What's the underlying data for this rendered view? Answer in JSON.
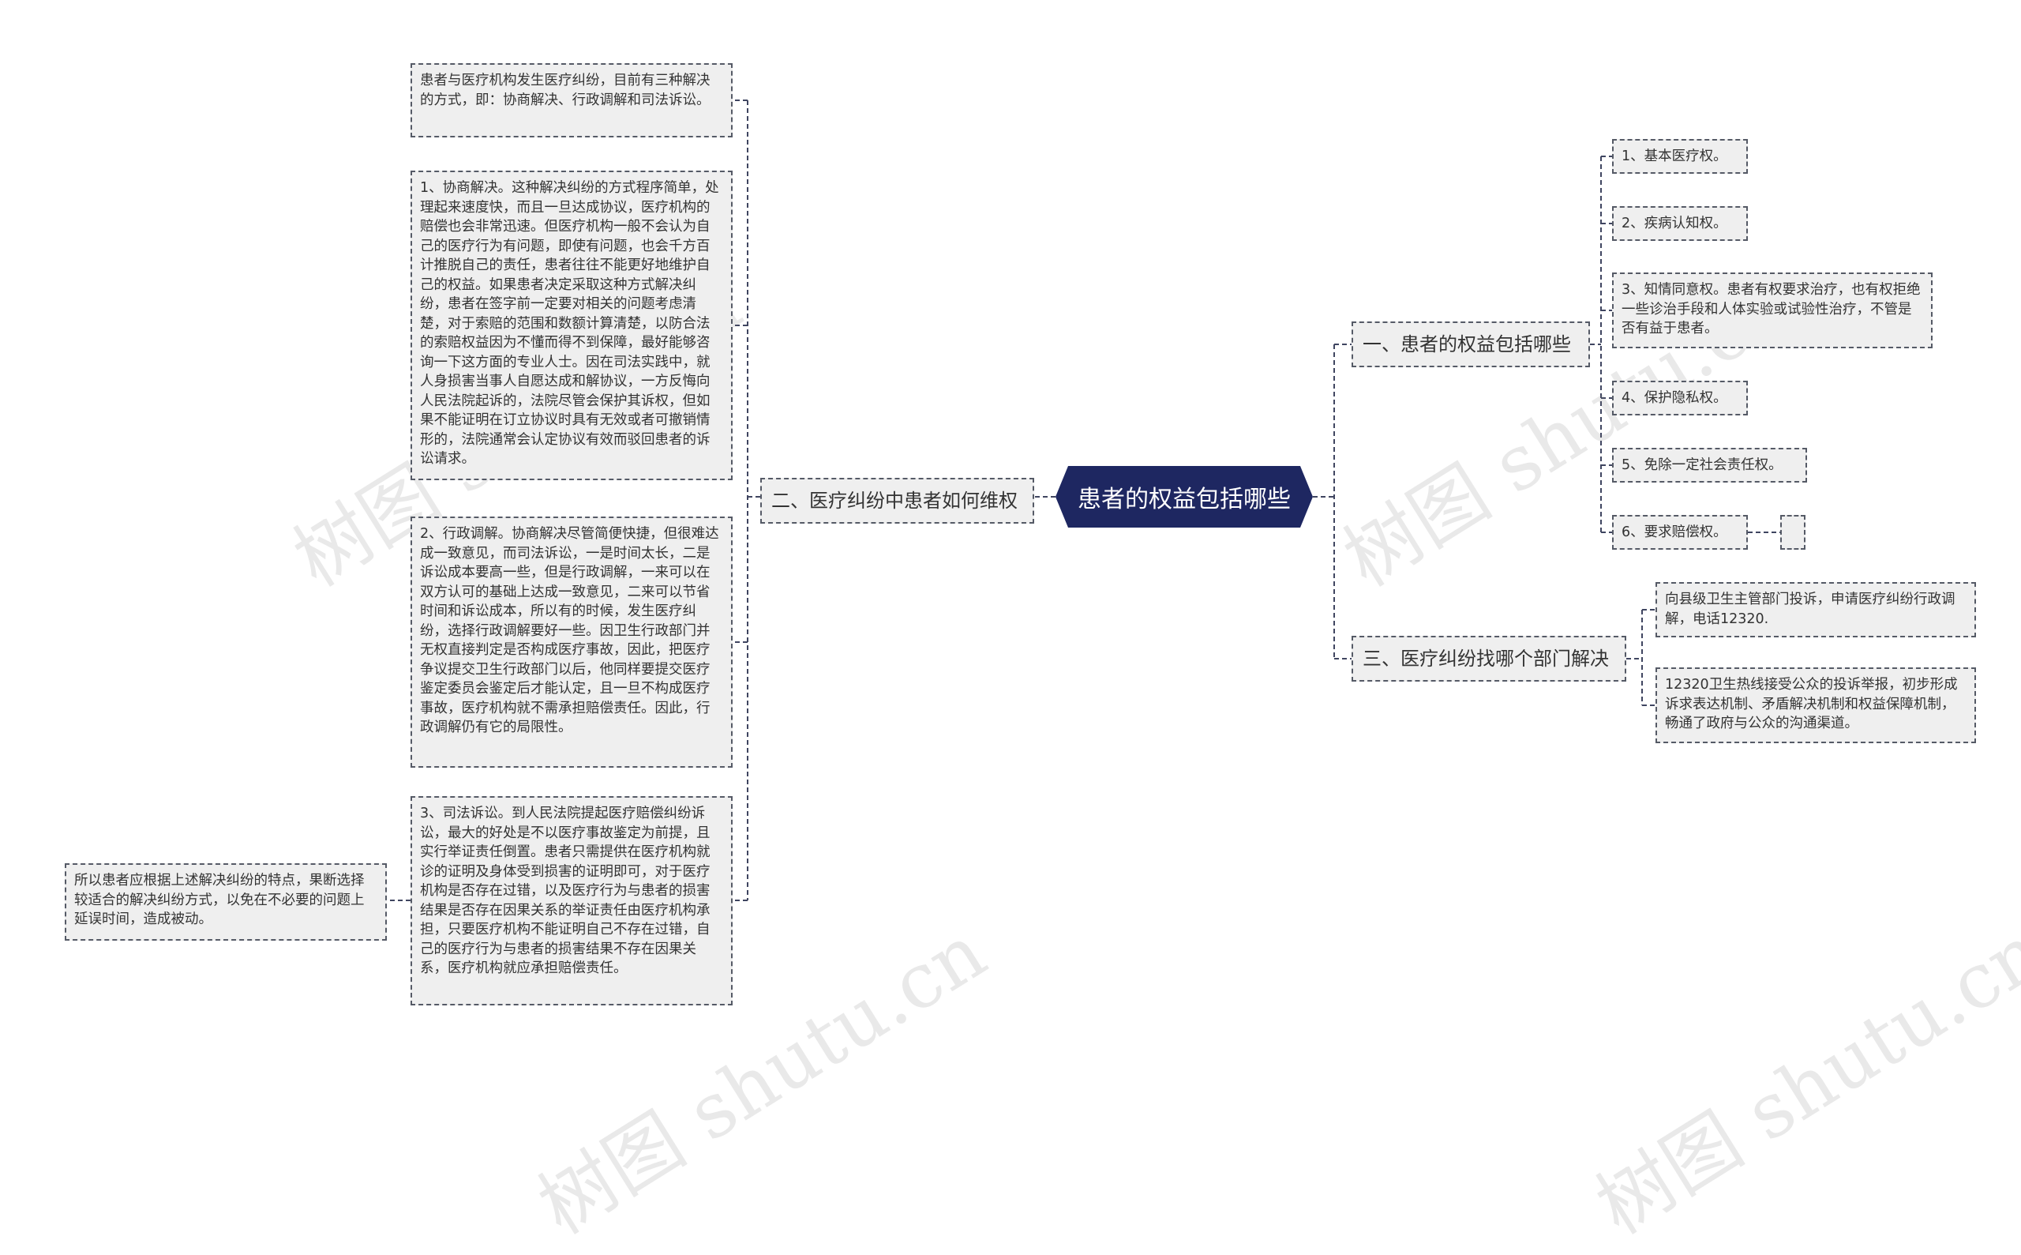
{
  "colors": {
    "root_fill": "#1e2761",
    "node_fill": "#efefef",
    "line": "#3f4560"
  },
  "root": {
    "label": "患者的权益包括哪些"
  },
  "branch_left": {
    "label": "二、医疗纠纷中患者如何维权",
    "items": [
      "患者与医疗机构发生医疗纠纷，目前有三种解决的方式，即：协商解决、行政调解和司法诉讼。",
      "1、协商解决。这种解决纠纷的方式程序简单，处理起来速度快，而且一旦达成协议，医疗机构的赔偿也会非常迅速。但医疗机构一般不会认为自己的医疗行为有问题，即使有问题，也会千方百计推脱自己的责任，患者往往不能更好地维护自己的权益。如果患者决定采取这种方式解决纠纷，患者在签字前一定要对相关的问题考虑清楚，对于索赔的范围和数额计算清楚，以防合法的索赔权益因为不懂而得不到保障，最好能够咨询一下这方面的专业人士。因在司法实践中，就人身损害当事人自愿达成和解协议，一方反悔向人民法院起诉的，法院尽管会保护其诉权，但如果不能证明在订立协议时具有无效或者可撤销情形的，法院通常会认定协议有效而驳回患者的诉讼请求。",
      "2、行政调解。协商解决尽管简便快捷，但很难达成一致意见，而司法诉讼，一是时间太长，二是诉讼成本要高一些，但是行政调解，一来可以在双方认可的基础上达成一致意见，二来可以节省时间和诉讼成本，所以有的时候，发生医疗纠纷，选择行政调解要好一些。因卫生行政部门并无权直接判定是否构成医疗事故，因此，把医疗争议提交卫生行政部门以后，他同样要提交医疗鉴定委员会鉴定后才能认定，且一旦不构成医疗事故，医疗机构就不需承担赔偿责任。因此，行政调解仍有它的局限性。",
      "3、司法诉讼。到人民法院提起医疗赔偿纠纷诉讼，最大的好处是不以医疗事故鉴定为前提，且实行举证责任倒置。患者只需提供在医疗机构就诊的证明及身体受到损害的证明即可，对于医疗机构是否存在过错，以及医疗行为与患者的损害结果是否存在因果关系的举证责任由医疗机构承担，只要医疗机构不能证明自己不存在过错，自己的医疗行为与患者的损害结果不存在因果关系，医疗机构就应承担赔偿责任。"
    ],
    "note": "所以患者应根据上述解决纠纷的特点，果断选择较适合的解决纠纷方式，以免在不必要的问题上延误时间，造成被动。"
  },
  "branch_right1": {
    "label": "一、患者的权益包括哪些",
    "items": [
      "1、基本医疗权。",
      "2、疾病认知权。",
      "3、知情同意权。患者有权要求治疗，也有权拒绝一些诊治手段和人体实验或试验性治疗，不管是否有益于患者。",
      "4、保护隐私权。",
      "5、免除一定社会责任权。",
      "6、要求赔偿权。"
    ],
    "empty_child": ""
  },
  "branch_right2": {
    "label": "三、医疗纠纷找哪个部门解决",
    "items": [
      "向县级卫生主管部门投诉，申请医疗纠纷行政调解，电话12320.",
      "12320卫生热线接受公众的投诉举报，初步形成诉求表达机制、矛盾解决机制和权益保障机制，畅通了政府与公众的沟通渠道。"
    ]
  },
  "watermarks": [
    "树图 shutu.cn",
    "树图 shutu.cn",
    "树图 shutu.cn",
    "树图 shutu.cn"
  ]
}
